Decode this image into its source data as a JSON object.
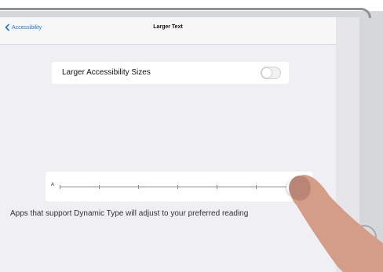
{
  "navbar": {
    "back_label": "Accessibility",
    "title": "Larger Text"
  },
  "settings": {
    "larger_sizes_label": "Larger Accessibility Sizes",
    "larger_sizes_enabled": false
  },
  "slider": {
    "small_label": "A",
    "steps": 7,
    "value_fraction": 1.0
  },
  "footer": {
    "description": "Apps that support Dynamic Type will adjust to your preferred reading"
  },
  "colors": {
    "accent": "#1a73e8",
    "background": "#efeff4",
    "card": "#ffffff"
  }
}
